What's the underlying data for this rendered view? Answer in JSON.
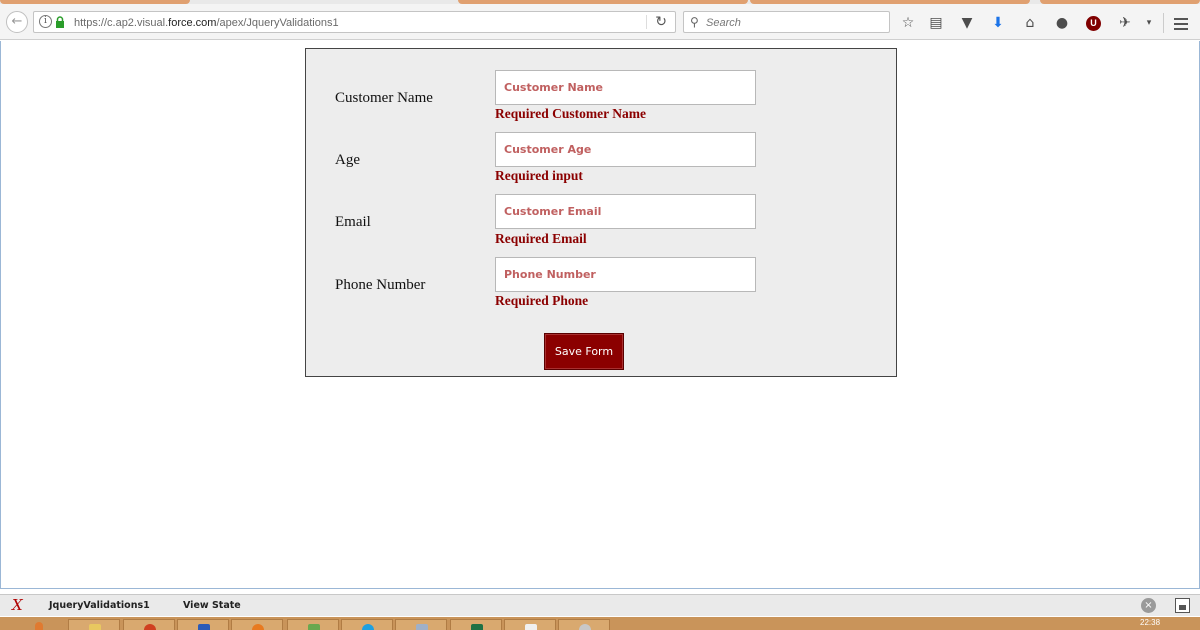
{
  "browser": {
    "url_prefix": "https://c.ap2.visual.",
    "url_domain": "force.com",
    "url_path": "/apex/JqueryValidations1",
    "search_placeholder": "Search"
  },
  "form": {
    "fields": [
      {
        "label": "Customer Name",
        "placeholder": "Customer Name",
        "error": "Required Customer Name"
      },
      {
        "label": "Age",
        "placeholder": "Customer Age",
        "error": "Required input"
      },
      {
        "label": "Email",
        "placeholder": "Customer Email",
        "error": "Required Email"
      },
      {
        "label": "Phone Number",
        "placeholder": "Phone Number",
        "error": "Required Phone"
      }
    ],
    "save_label": "Save Form"
  },
  "dev_footer": {
    "page_name": "JqueryValidations1",
    "view_state": "View State"
  },
  "taskbar": {
    "clock": "22:38"
  },
  "colors": {
    "accent": "#8b0000",
    "panel": "#ededed",
    "taskbar": "#c9945a"
  }
}
